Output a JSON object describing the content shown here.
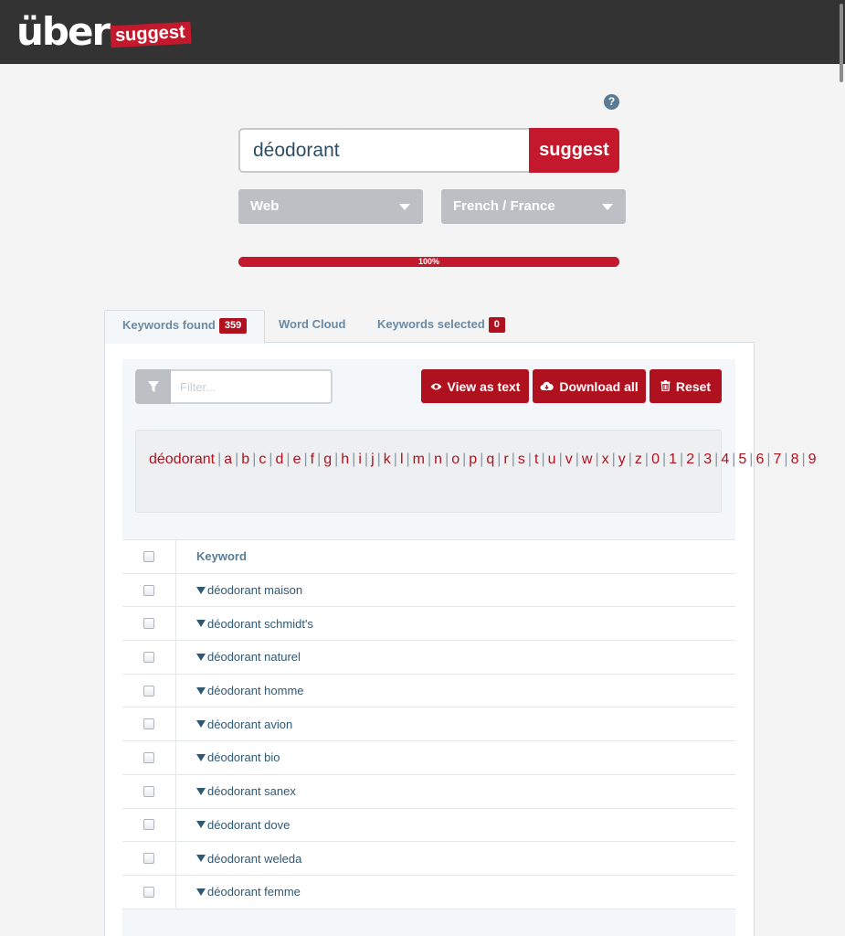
{
  "brand": {
    "part1": "über",
    "part2": "suggest"
  },
  "help": {
    "glyph": "?"
  },
  "search": {
    "value": "déodorant",
    "button_label": "suggest"
  },
  "filters": {
    "source": "Web",
    "language": "French / France"
  },
  "progress": {
    "label": "100%",
    "value": 100
  },
  "tabs": [
    {
      "label": "Keywords found",
      "badge": "359"
    },
    {
      "label": "Word Cloud"
    },
    {
      "label": "Keywords selected",
      "badge": "0"
    }
  ],
  "toolbar": {
    "filter_placeholder": "Filter...",
    "view_as_text": "View as text",
    "download_all": "Download all",
    "reset": "Reset"
  },
  "letters": [
    "déodorant",
    "a",
    "b",
    "c",
    "d",
    "e",
    "f",
    "g",
    "h",
    "i",
    "j",
    "k",
    "l",
    "m",
    "n",
    "o",
    "p",
    "q",
    "r",
    "s",
    "t",
    "u",
    "v",
    "w",
    "x",
    "y",
    "z",
    "0",
    "1",
    "2",
    "3",
    "4",
    "5",
    "6",
    "7",
    "8",
    "9"
  ],
  "table": {
    "header": "Keyword",
    "rows": [
      "déodorant maison",
      "déodorant schmidt's",
      "déodorant naturel",
      "déodorant homme",
      "déodorant avion",
      "déodorant bio",
      "déodorant sanex",
      "déodorant dove",
      "déodorant weleda",
      "déodorant femme"
    ]
  },
  "colors": {
    "brand_red": "#c4182c",
    "topbar": "#333333",
    "link_blue": "#2f5873"
  }
}
